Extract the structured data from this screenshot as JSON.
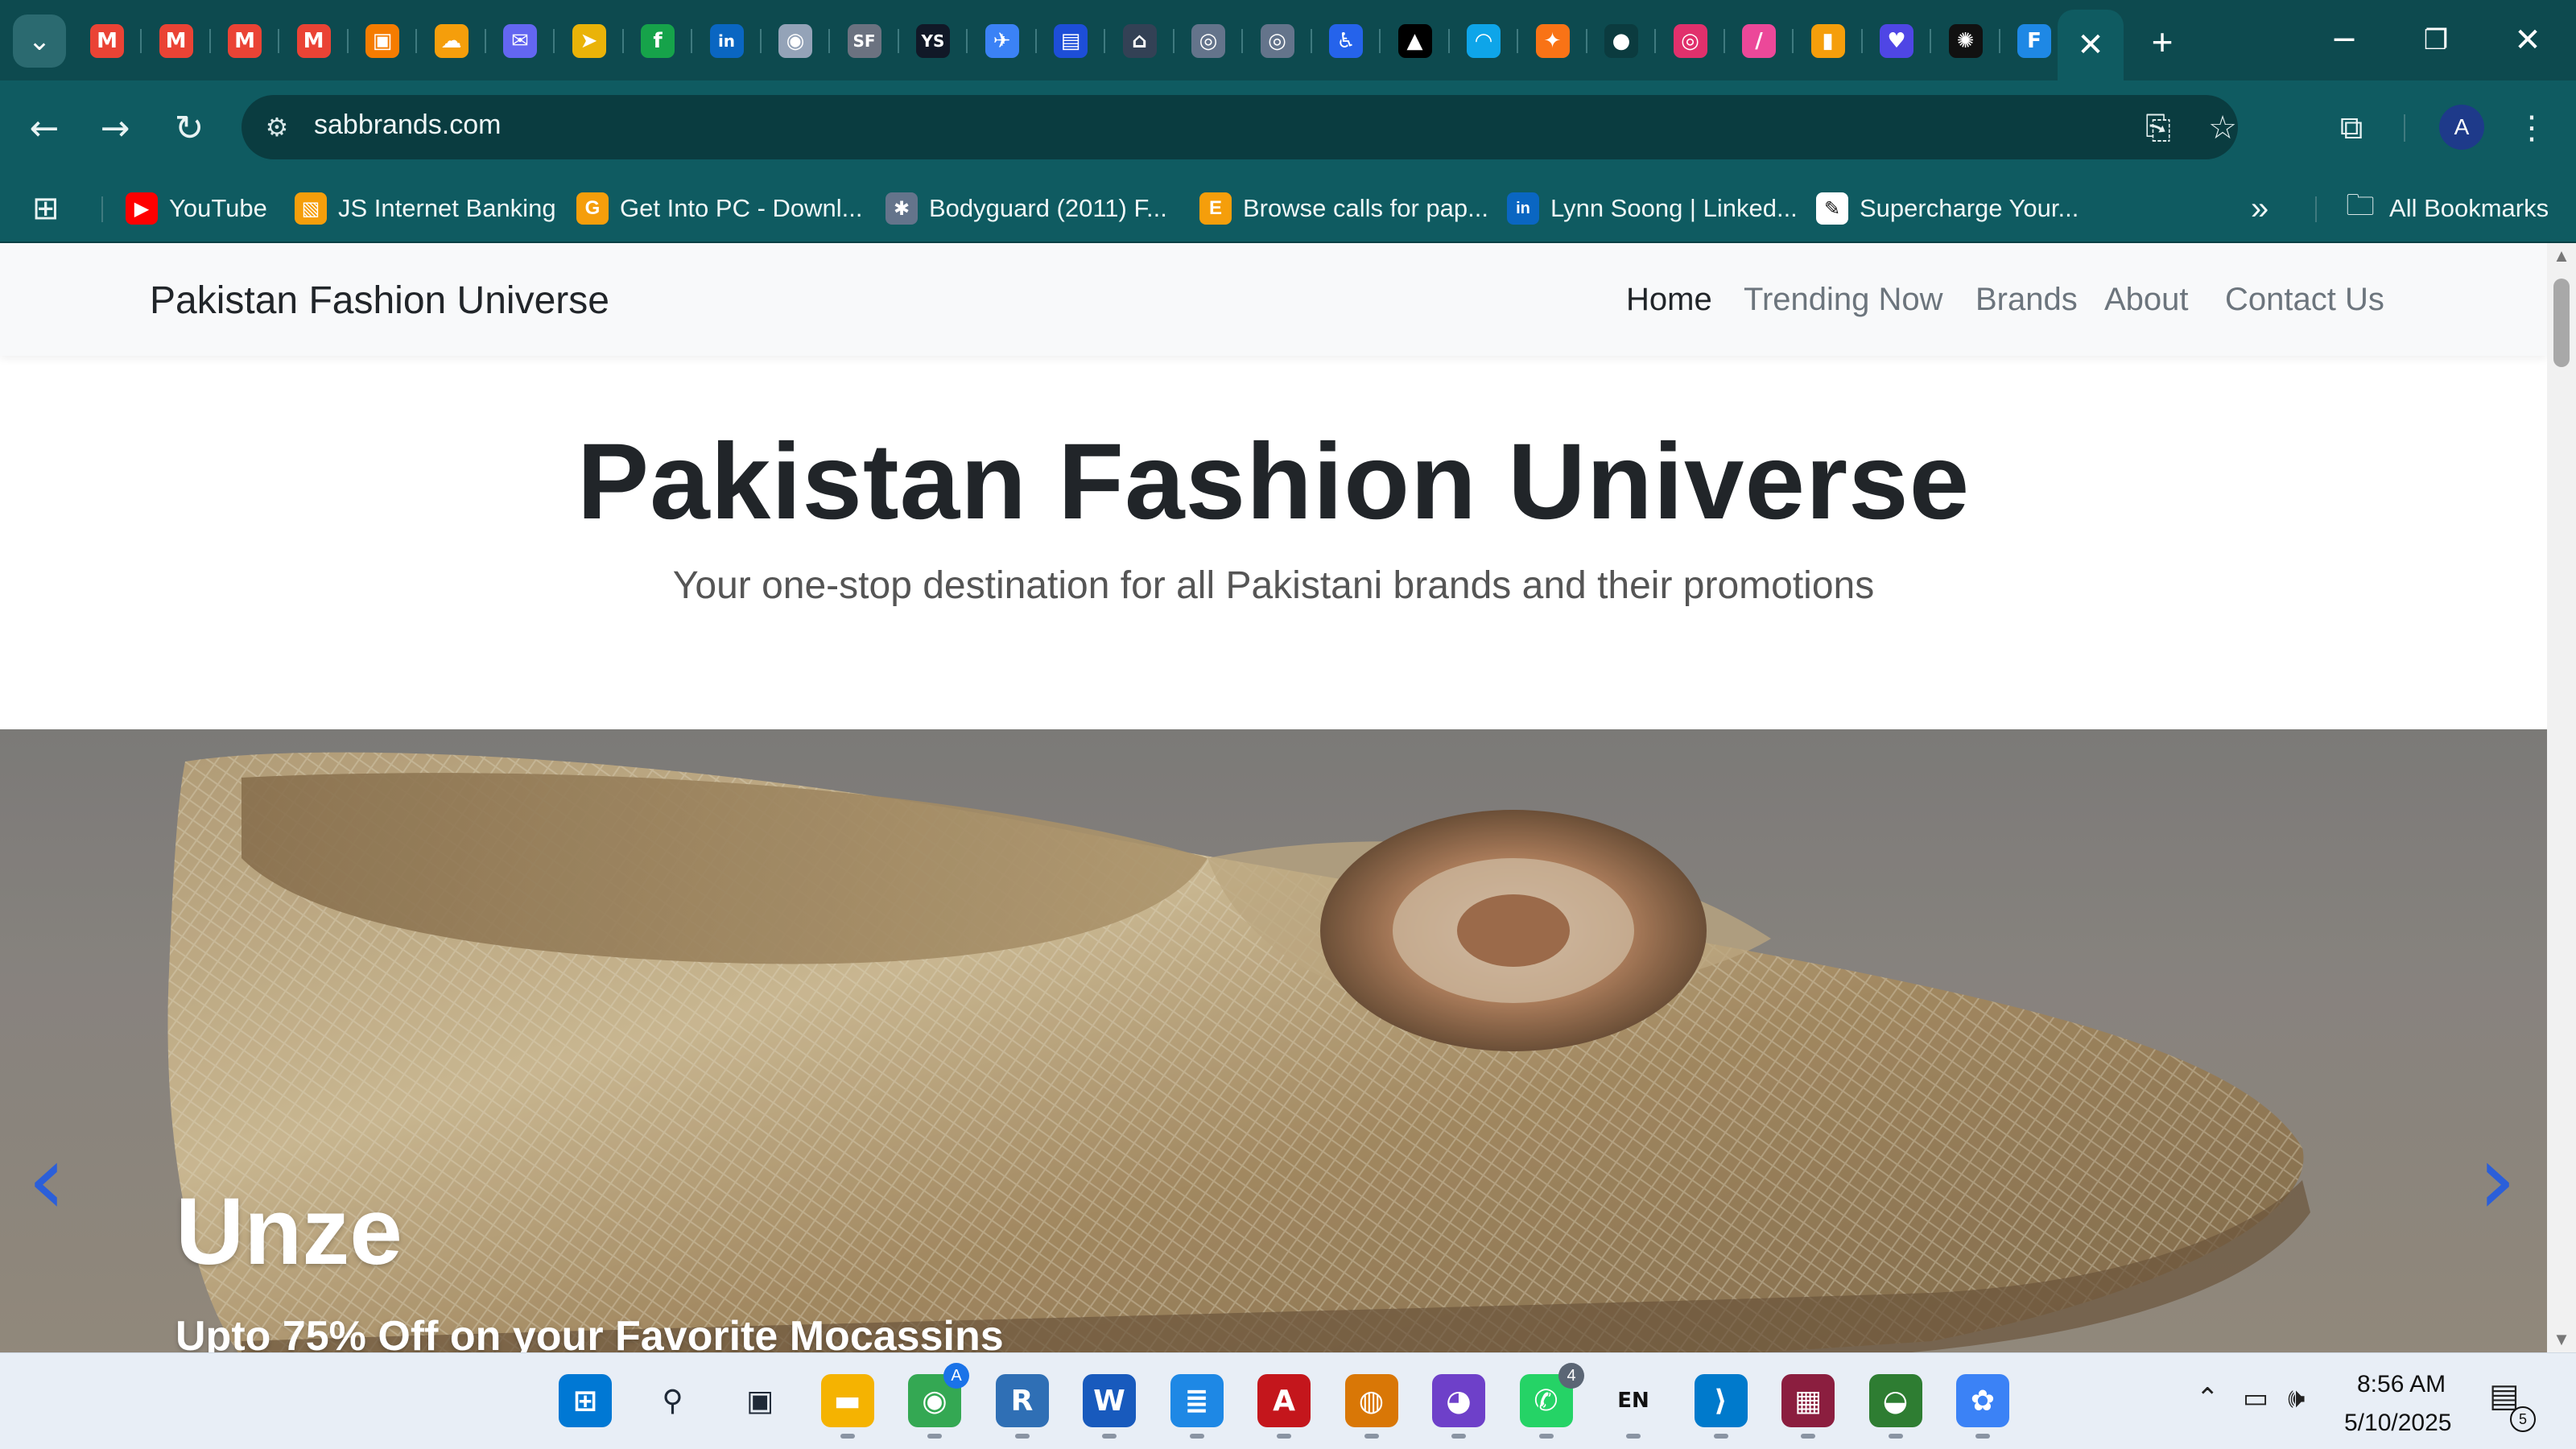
{
  "browser": {
    "pinned_tabs": [
      {
        "icon": "gmail-icon",
        "glyph": "M",
        "color": "#ea4335"
      },
      {
        "icon": "gmail-icon",
        "glyph": "M",
        "color": "#ea4335"
      },
      {
        "icon": "gmail-icon",
        "glyph": "M",
        "color": "#ea4335"
      },
      {
        "icon": "gmail-icon",
        "glyph": "M",
        "color": "#ea4335"
      },
      {
        "icon": "app-icon",
        "glyph": "▣",
        "color": "#f57c00"
      },
      {
        "icon": "cloud-icon",
        "glyph": "☁",
        "color": "#f59e0b"
      },
      {
        "icon": "mail-icon",
        "glyph": "✉",
        "color": "#6366f1"
      },
      {
        "icon": "app-icon",
        "glyph": "➤",
        "color": "#eab308"
      },
      {
        "icon": "app-icon",
        "glyph": "f",
        "color": "#16a34a"
      },
      {
        "icon": "linkedin-icon",
        "glyph": "in",
        "color": "#0a66c2"
      },
      {
        "icon": "app-icon",
        "glyph": "◉",
        "color": "#94a3b8"
      },
      {
        "icon": "app-icon",
        "glyph": "SF",
        "color": "#6b7280"
      },
      {
        "icon": "app-icon",
        "glyph": "YS",
        "color": "#111827"
      },
      {
        "icon": "app-icon",
        "glyph": "✈",
        "color": "#3b82f6"
      },
      {
        "icon": "app-icon",
        "glyph": "▤",
        "color": "#1d4ed8"
      },
      {
        "icon": "store-icon",
        "glyph": "⌂",
        "color": "#334155"
      },
      {
        "icon": "emblem-icon",
        "glyph": "◎",
        "color": "#64748b"
      },
      {
        "icon": "emblem-icon",
        "glyph": "◎",
        "color": "#64748b"
      },
      {
        "icon": "accessibility-icon",
        "glyph": "♿",
        "color": "#2563eb"
      },
      {
        "icon": "app-icon",
        "glyph": "▲",
        "color": "#000000"
      },
      {
        "icon": "app-icon",
        "glyph": "◠",
        "color": "#0ea5e9"
      },
      {
        "icon": "app-icon",
        "glyph": "✦",
        "color": "#f97316"
      },
      {
        "icon": "app-icon",
        "glyph": "●",
        "color": "#0b3b3f"
      },
      {
        "icon": "instagram-icon",
        "glyph": "◎",
        "color": "#e1306c"
      },
      {
        "icon": "app-icon",
        "glyph": "∕",
        "color": "#ec4899"
      },
      {
        "icon": "analytics-icon",
        "glyph": "▮",
        "color": "#f59e0b"
      },
      {
        "icon": "heart-icon",
        "glyph": "♥",
        "color": "#4f46e5"
      },
      {
        "icon": "openai-icon",
        "glyph": "✺",
        "color": "#111111"
      },
      {
        "icon": "app-icon",
        "glyph": "F",
        "color": "#1e88e5"
      }
    ],
    "active_tab_close": "✕",
    "new_tab": "+",
    "window_controls": {
      "minimize": "─",
      "restore": "❐",
      "close": "✕"
    },
    "url": "sabbrands.com",
    "profile_initial": "A",
    "bookmarks": [
      {
        "label": "YouTube",
        "icon": "youtube-icon",
        "glyph": "▶",
        "color": "#ff0000"
      },
      {
        "label": "JS Internet Banking",
        "icon": "bank-icon",
        "glyph": "▧",
        "color": "#f59e0b"
      },
      {
        "label": "Get Into PC - Downl...",
        "icon": "getintopc-icon",
        "glyph": "G",
        "color": "#f59e0b"
      },
      {
        "label": "Bodyguard (2011) F...",
        "icon": "film-icon",
        "glyph": "✱",
        "color": "#64748b"
      },
      {
        "label": "Browse calls for pap...",
        "icon": "elsevier-icon",
        "glyph": "E",
        "color": "#f59e0b"
      },
      {
        "label": "Lynn Soong | Linked...",
        "icon": "linkedin-icon",
        "glyph": "in",
        "color": "#0a66c2"
      },
      {
        "label": "Supercharge Your...",
        "icon": "app-icon",
        "glyph": "✎",
        "color": "#ffffff"
      }
    ],
    "more_bookmarks": "»",
    "all_bookmarks": "All Bookmarks"
  },
  "site": {
    "brand": "Pakistan Fashion Universe",
    "nav": [
      "Home",
      "Trending Now",
      "Brands",
      "About",
      "Contact Us"
    ],
    "hero_title": "Pakistan Fashion Universe",
    "hero_subtitle": "Your one-stop destination for all Pakistani brands and their promotions",
    "slide": {
      "title": "Unze",
      "caption": "Upto 75% Off on your Favorite Mocassins",
      "prev": "‹",
      "next": "›"
    }
  },
  "taskbar": {
    "apps": [
      {
        "icon": "windows-start-icon",
        "glyph": "⊞",
        "color": "#0078d4"
      },
      {
        "icon": "search-icon",
        "glyph": "⚲",
        "color": "#1f2937"
      },
      {
        "icon": "task-view-icon",
        "glyph": "▣",
        "color": "#1f2937"
      },
      {
        "icon": "file-explorer-icon",
        "glyph": "▬",
        "color": "#f5b301"
      },
      {
        "icon": "chrome-icon",
        "glyph": "◉",
        "color": "#34a853"
      },
      {
        "icon": "r-icon",
        "glyph": "R",
        "color": "#2f6fb5"
      },
      {
        "icon": "word-icon",
        "glyph": "W",
        "color": "#185abd"
      },
      {
        "icon": "notepad-icon",
        "glyph": "≣",
        "color": "#1e88e5"
      },
      {
        "icon": "acrobat-icon",
        "glyph": "A",
        "color": "#c4161c"
      },
      {
        "icon": "app-icon",
        "glyph": "◍",
        "color": "#d97706"
      },
      {
        "icon": "github-icon",
        "glyph": "◕",
        "color": "#6e40c9"
      },
      {
        "icon": "whatsapp-icon",
        "glyph": "✆",
        "color": "#25d366"
      },
      {
        "icon": "keyboard-icon",
        "glyph": "EN",
        "color": "#111111"
      },
      {
        "icon": "vscode-icon",
        "glyph": "⟩",
        "color": "#007acc"
      },
      {
        "icon": "winrar-icon",
        "glyph": "▦",
        "color": "#8b1e3f"
      },
      {
        "icon": "globe-icon",
        "glyph": "◒",
        "color": "#2e7d32"
      },
      {
        "icon": "paint-icon",
        "glyph": "✿",
        "color": "#3b82f6"
      }
    ],
    "whatsapp_badge": "4",
    "chrome_badge": "A",
    "time": "8:56 AM",
    "date": "5/10/2025",
    "notifications": "5"
  }
}
